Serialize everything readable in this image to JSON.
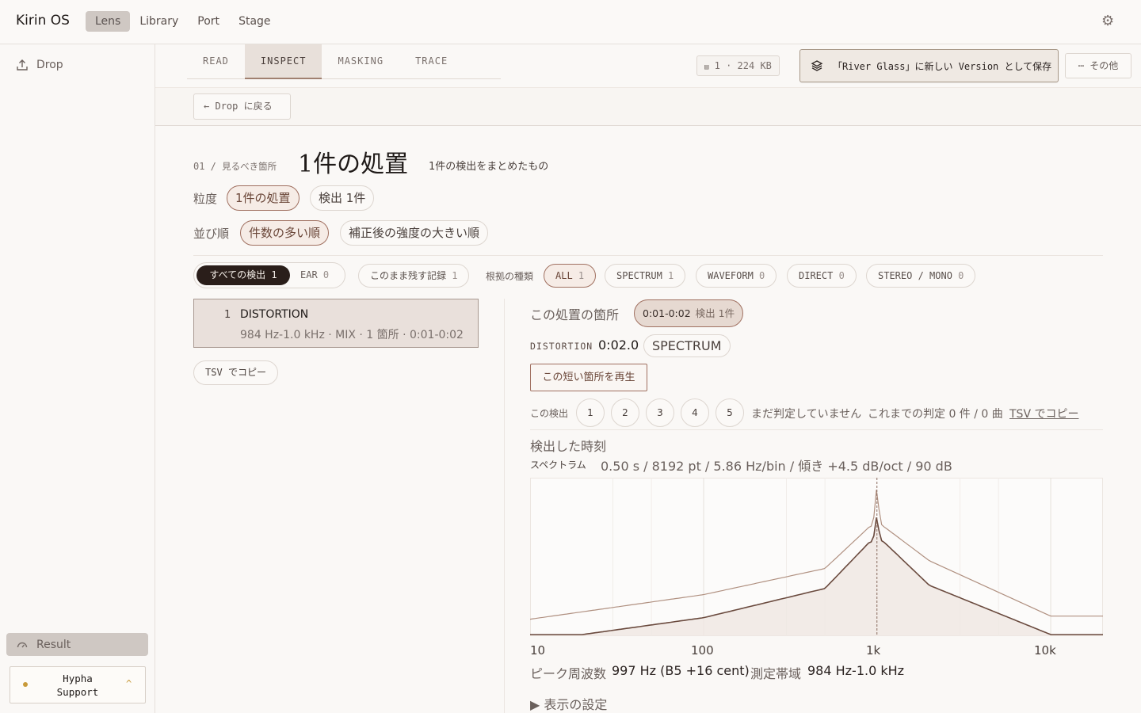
{
  "app": {
    "brand": "Kirin OS",
    "nav": [
      "Lens",
      "Library",
      "Port",
      "Stage"
    ],
    "active_nav": "Lens"
  },
  "sidebar": {
    "drop": "Drop",
    "result": "Result",
    "support_line1": "Hypha",
    "support_line2": "Support",
    "support_chevron": "^"
  },
  "tabs": [
    "READ",
    "INSPECT",
    "MASKING",
    "TRACE"
  ],
  "active_tab": "INSPECT",
  "file_badge": "1 · 224 KB",
  "save_button": "「River Glass」に新しい Version として保存",
  "more_button": "その他",
  "back_button": "Drop に戻る",
  "heading": {
    "crumb_num": "01 /",
    "crumb_text": "見るべき箇所",
    "title": "1件の処置",
    "subtitle": "1件の検出をまとめたもの"
  },
  "granularity": {
    "label": "粒度",
    "options": [
      "1件の処置",
      "検出 1件"
    ]
  },
  "sort": {
    "label": "並び順",
    "options": [
      "件数の多い順",
      "補正後の強度の大きい順"
    ]
  },
  "filters": {
    "seg_all": "すべての検出",
    "seg_all_count": "1",
    "seg_ear": "EAR",
    "seg_ear_count": "0",
    "keep": "このまま残す記録",
    "keep_count": "1",
    "evidence_label": "根拠の種類",
    "evidence": [
      {
        "label": "ALL",
        "count": "1"
      },
      {
        "label": "SPECTRUM",
        "count": "1"
      },
      {
        "label": "WAVEFORM",
        "count": "0"
      },
      {
        "label": "DIRECT",
        "count": "0"
      },
      {
        "label": "STEREO / MONO",
        "count": "0"
      }
    ]
  },
  "list": [
    {
      "num": "1",
      "title": "DISTORTION",
      "meta": "984 Hz-1.0 kHz · MIX · 1 箇所 · 0:01-0:02"
    }
  ],
  "tsv_button": "TSV でコピー",
  "detail": {
    "section_label": "この処置の箇所",
    "range_pill": "0:01-0:02",
    "range_pill_sub": "検出 1件",
    "tag": "DISTORTION",
    "time": "0:02.0",
    "evidence": "SPECTRUM",
    "play_button": "この短い箇所を再生",
    "rate_label": "この検出",
    "ratings": [
      "1",
      "2",
      "3",
      "4",
      "5"
    ],
    "rate_status": "まだ判定していません",
    "rate_history": "これまでの判定 0 件 / 0 曲",
    "rate_copy": "TSV でコピー",
    "detect_title": "検出した時刻",
    "spec_label": "スペクトラム",
    "spec_value": "0.50 s / 8192 pt / 5.86 Hz/bin / 傾き +4.5 dB/oct / 90 dB",
    "peak_label": "ピーク周波数",
    "peak_value": "997 Hz (B5 +16 cent)",
    "band_label": "測定帯域",
    "band_value": "984 Hz-1.0 kHz",
    "display_settings": "▶ 表示の設定"
  },
  "chart_data": {
    "type": "line",
    "xscale": "log",
    "xlim": [
      10,
      20000
    ],
    "x_ticks": [
      "10",
      "100",
      "1k",
      "10k"
    ],
    "peak_hz": 997,
    "series": [
      {
        "x": [
          10,
          100,
          500,
          900,
          997,
          1100,
          2000,
          10000,
          20000
        ],
        "y": [
          0.1,
          0.26,
          0.43,
          0.7,
          1.0,
          0.7,
          0.48,
          0.12,
          0.12
        ]
      },
      {
        "x": [
          10,
          20,
          100,
          500,
          900,
          997,
          1100,
          2000,
          10000,
          20000
        ],
        "y": [
          0.0,
          0.0,
          0.11,
          0.3,
          0.6,
          0.8,
          0.6,
          0.32,
          0.0,
          0.0
        ]
      }
    ],
    "colors": {
      "upper": "#b09080",
      "lower": "#6a4a3e",
      "fill": "#efe7e2",
      "peak_line": "#8a6a5e"
    }
  }
}
